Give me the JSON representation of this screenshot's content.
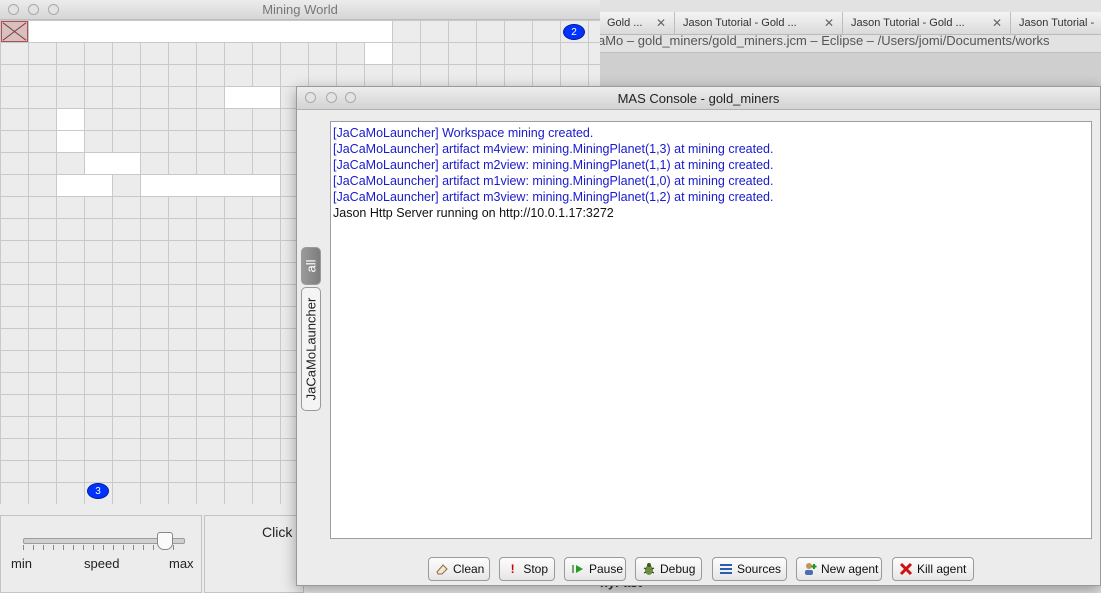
{
  "eclipse": {
    "tabs": [
      {
        "label": "Gold ..."
      },
      {
        "label": "Jason Tutorial - Gold ..."
      },
      {
        "label": "Jason Tutorial - Gold ..."
      },
      {
        "label": "Jason Tutorial -"
      }
    ],
    "title": "aMo – gold_miners/gold_miners.jcm – Eclipse – /Users/jomi/Documents/works",
    "bottom_text": "nyFast"
  },
  "mining_world": {
    "title": "Mining World",
    "agents": [
      {
        "label": "2"
      },
      {
        "label": "3"
      }
    ],
    "speed": {
      "min_label": "min",
      "speed_label": "speed",
      "max_label": "max",
      "value_fraction": 0.88
    },
    "click_text": "Click"
  },
  "console": {
    "title": "MAS Console - gold_miners",
    "tabs": [
      {
        "label": "all"
      },
      {
        "label": "JaCaMoLauncher"
      }
    ],
    "lines": [
      {
        "text": "[JaCaMoLauncher] Workspace mining created.",
        "color": "#1a1acc"
      },
      {
        "text": "[JaCaMoLauncher] artifact m4view: mining.MiningPlanet(1,3) at mining created.",
        "color": "#1a1acc"
      },
      {
        "text": "[JaCaMoLauncher] artifact m2view: mining.MiningPlanet(1,1) at mining created.",
        "color": "#1a1acc"
      },
      {
        "text": "[JaCaMoLauncher] artifact m1view: mining.MiningPlanet(1,0) at mining created.",
        "color": "#1a1acc"
      },
      {
        "text": "[JaCaMoLauncher] artifact m3view: mining.MiningPlanet(1,2) at mining created.",
        "color": "#1a1acc"
      },
      {
        "text": "Jason Http Server running on http://10.0.1.17:3272",
        "color": "#111111"
      }
    ],
    "buttons": [
      {
        "label": "Clean",
        "icon": "eraser-icon"
      },
      {
        "label": "Stop",
        "icon": "exclamation-icon"
      },
      {
        "label": "Pause",
        "icon": "play-pause-icon"
      },
      {
        "label": "Debug",
        "icon": "bug-icon"
      },
      {
        "label": "Sources",
        "icon": "list-icon"
      },
      {
        "label": "New agent",
        "icon": "add-agent-icon"
      },
      {
        "label": "Kill agent",
        "icon": "red-x-icon"
      }
    ]
  }
}
